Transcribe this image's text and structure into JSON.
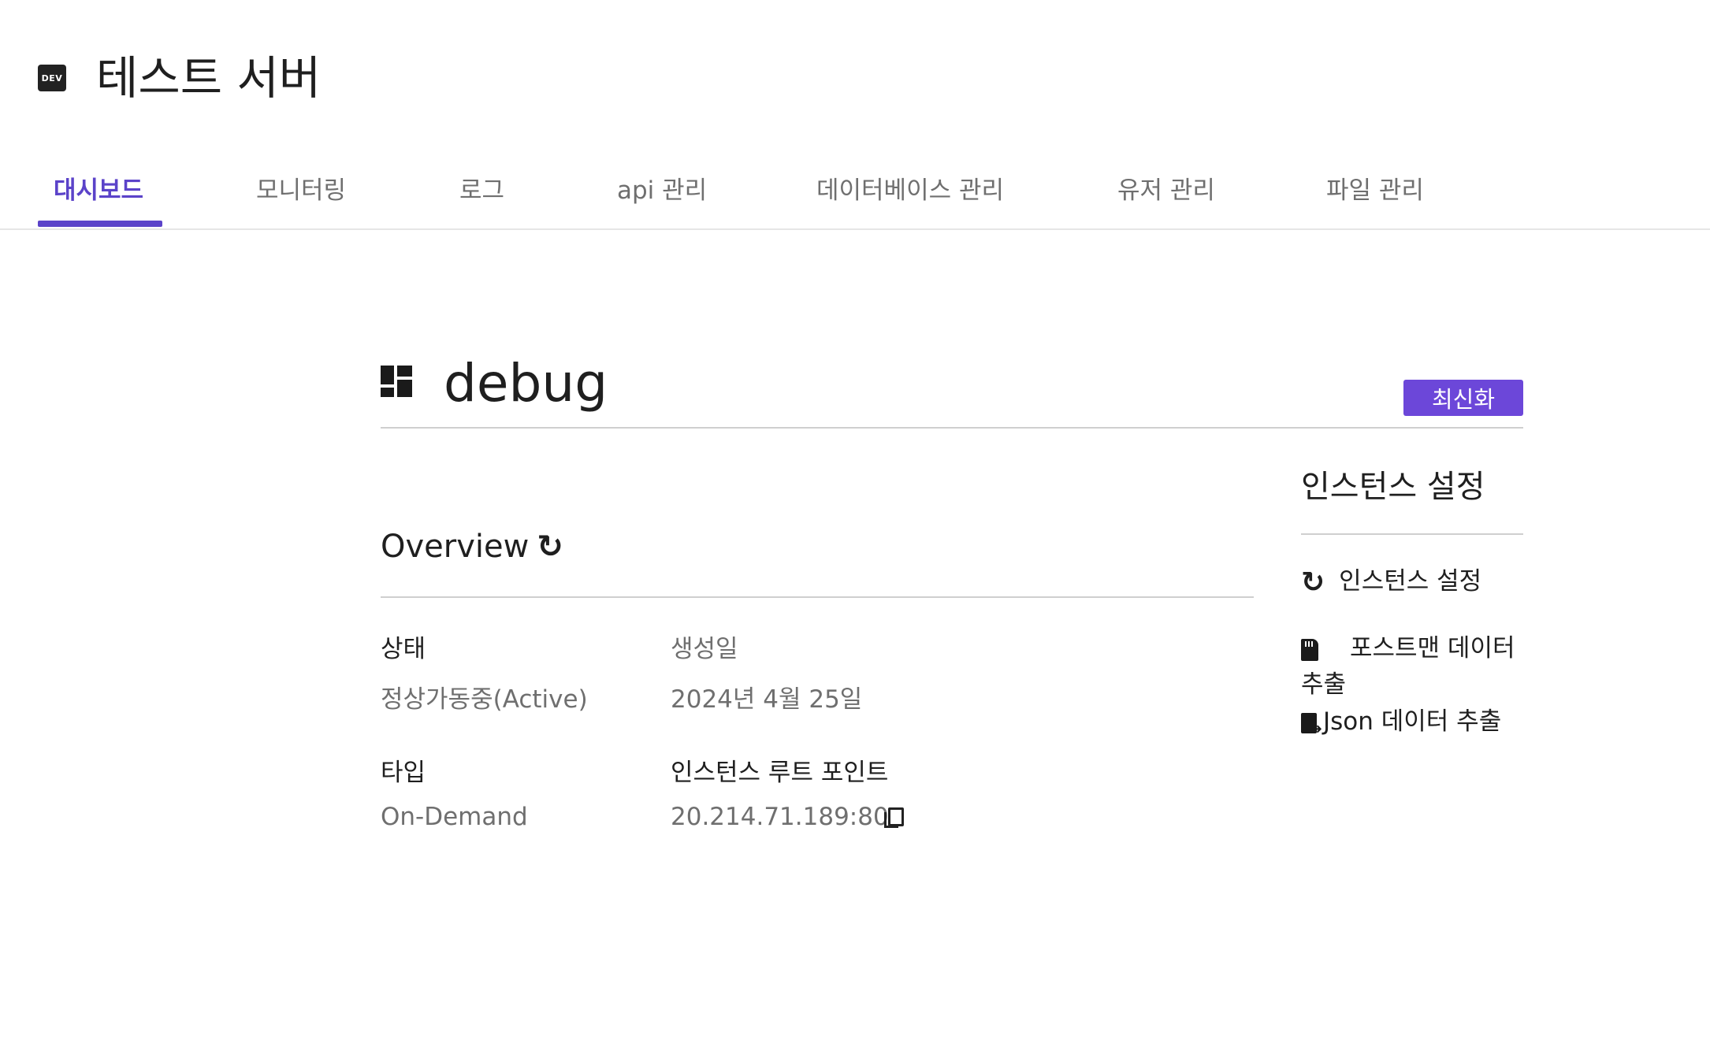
{
  "header": {
    "badge": "DEV",
    "title": "테스트 서버"
  },
  "tabs": [
    {
      "label": "대시보드",
      "active": true
    },
    {
      "label": "모니터링",
      "active": false
    },
    {
      "label": "로그",
      "active": false
    },
    {
      "label": "api 관리",
      "active": false
    },
    {
      "label": "데이터베이스 관리",
      "active": false
    },
    {
      "label": "유저 관리",
      "active": false
    },
    {
      "label": "파일 관리",
      "active": false
    }
  ],
  "instance": {
    "name": "debug",
    "refresh_label": "최신화"
  },
  "overview": {
    "title": "Overview",
    "fields": {
      "status_label": "상태",
      "status_value": "정상가동중(Active)",
      "created_label": "생성일",
      "created_value": "2024년 4월 25일",
      "type_label": "타입",
      "type_value": "On-Demand",
      "endpoint_label": "인스턴스 루트 포인트",
      "endpoint_value": "20.214.71.189:80"
    }
  },
  "sidebar": {
    "title": "인스턴스 설정",
    "items": [
      {
        "icon": "reload-icon",
        "label": "인스턴스 설정"
      },
      {
        "icon": "sd-card-icon",
        "label": "포스트맨 데이터 추출"
      },
      {
        "icon": "export-icon",
        "label": "Json 데이터 추출"
      }
    ]
  },
  "colors": {
    "accent": "#5b43c9",
    "button": "#6c47d9",
    "muted_text": "#6f6f6f"
  }
}
